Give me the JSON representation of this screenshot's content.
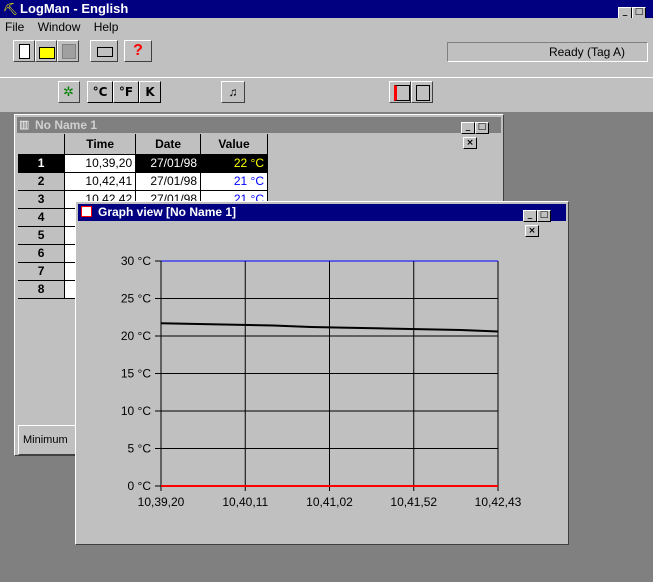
{
  "app": {
    "title": "LogMan - English",
    "menu": [
      "File",
      "Window",
      "Help"
    ],
    "status": "Ready (Tag A)"
  },
  "toolbar2": {
    "celsius": "°C",
    "fahrenheit": "°F",
    "kelvin": "K"
  },
  "table_window": {
    "title": "No Name 1",
    "headers": [
      "Time",
      "Date",
      "Value"
    ],
    "rows": [
      {
        "n": "1",
        "time": "10,39,20",
        "date": "27/01/98",
        "value": "22 °C"
      },
      {
        "n": "2",
        "time": "10,42,41",
        "date": "27/01/98",
        "value": "21 °C"
      },
      {
        "n": "3",
        "time": "10,42,42",
        "date": "27/01/98",
        "value": "21 °C"
      },
      {
        "n": "4"
      },
      {
        "n": "5"
      },
      {
        "n": "6"
      },
      {
        "n": "7"
      },
      {
        "n": "8"
      }
    ],
    "minimum_label": "Minimum"
  },
  "graph_window": {
    "title": "Graph view [No Name 1]"
  },
  "colors": {
    "title_active": "#000080",
    "title_inactive": "#808080",
    "face": "#c0c0c0",
    "desktop": "#808080",
    "line_upper": "#0000ff",
    "line_lower": "#ff0000",
    "series": "#000000"
  },
  "chart_data": {
    "type": "line",
    "x": [
      "10,39,20",
      "10,40,11",
      "10,41,02",
      "10,41,52",
      "10,42,43"
    ],
    "y_ticks": [
      "30 °C",
      "25 °C",
      "20 °C",
      "15 °C",
      "10 °C",
      "5 °C",
      "0 °C"
    ],
    "ylim": [
      0,
      30
    ],
    "series": [
      {
        "values": [
          21.7,
          21.6,
          21.5,
          21.4,
          21.2,
          21.1,
          21.0,
          20.9,
          20.8,
          20.6
        ]
      }
    ],
    "upper_limit": 30,
    "lower_limit": 0,
    "grid": true
  }
}
